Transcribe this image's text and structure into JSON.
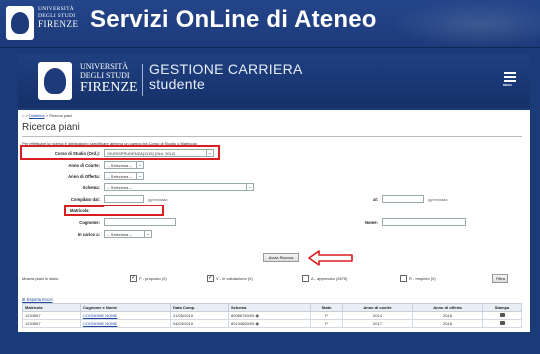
{
  "banner": {
    "uni_line1": "UNIVERSITÀ",
    "uni_line2": "DEGLI STUDI",
    "uni_line3": "FIRENZE",
    "title": "Servizi OnLine di Ateneo"
  },
  "app_header": {
    "uni_line1": "UNIVERSITÀ",
    "uni_line2": "DEGLI STUDI",
    "uni_line3": "FIRENZE",
    "title_line1": "GESTIONE CARRIERA",
    "title_line2": "studente",
    "menu_label": "MENU"
  },
  "breadcrumb": {
    "home": "⌂ >",
    "link": "Didattica",
    "current": "> Ricerca piani"
  },
  "page_title": "Ricerca piani",
  "intro": "Per effettuare la ricerca è obbligatorio specificare almeno un campo tra Corso di Studio o Matricola",
  "form": {
    "corso_label": "Corso di Studio (Ord.):",
    "corso_value": "GIURISPRUDENZA(1115) (Ord. 2012)",
    "anno_coorte_label": "Anno di Coorte:",
    "anno_coorte_value": "-- Seleziona --",
    "anno_offerta_label": "Anno di Offerta:",
    "anno_offerta_value": "-- Seleziona --",
    "schema_label": "Schema:",
    "schema_value": "-- Seleziona --",
    "compilato_label": "Compilato dal:",
    "al_label": "al:",
    "date_format": "gg/mm/aaaa",
    "matricola_label": "Matricola:",
    "cognome_label": "Cognome:",
    "nome_label": "Nome:",
    "in_carico_label": "In carico a:",
    "in_carico_value": "-- Seleziona --",
    "search_button": "Avvia Ricerca"
  },
  "filters": {
    "label": "Mostra piani in stato:",
    "items": [
      {
        "label": "P - proposto (2)",
        "checked": true
      },
      {
        "label": "V - in valutazione (0)",
        "checked": true
      },
      {
        "label": "A - approvato (2675)",
        "checked": false
      },
      {
        "label": "R - respinto (0)",
        "checked": false
      }
    ],
    "button": "Filtra"
  },
  "export_link": "Esporta Excel",
  "table": {
    "headers": [
      "Matricola",
      "Cognome e Nome",
      "Data Comp.",
      "Schema",
      "Stato",
      "Anno di coorte",
      "Anno di offerta",
      "Stampa"
    ],
    "rows": [
      [
        "1234567",
        "COGNOME NOME",
        "21/05/2019",
        "80086750/09",
        "P",
        "2014",
        "2018"
      ],
      [
        "1234567",
        "COGNOME NOME",
        "04/04/2019",
        "80134660/09",
        "P",
        "2017",
        "2018"
      ]
    ]
  },
  "colors": {
    "brand_blue": "#1b3a78",
    "highlight_red": "#d81e1e",
    "link_blue": "#1c4aa0"
  }
}
